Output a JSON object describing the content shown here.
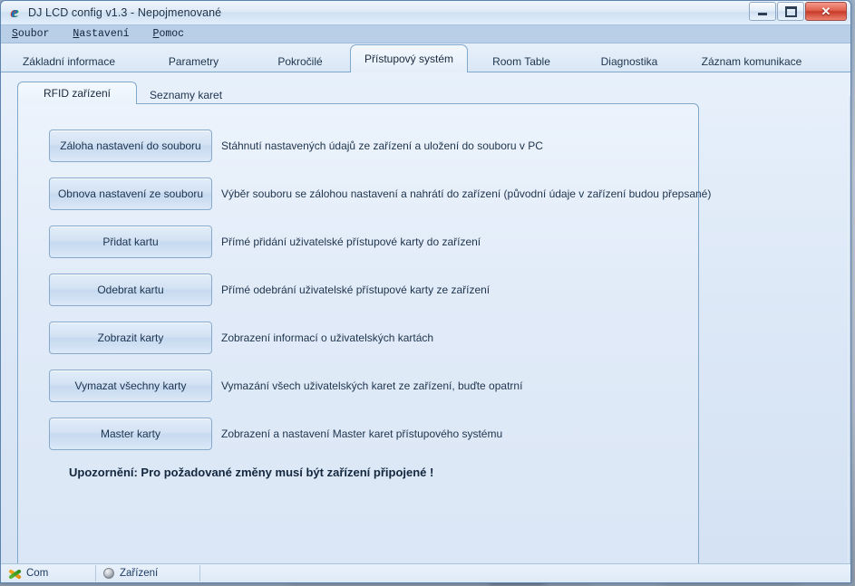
{
  "window": {
    "title": "DJ LCD config v1.3 - Nepojmenované",
    "icon": "ie-logo-icon",
    "controls": {
      "minimize": "–",
      "maximize": "□",
      "close": "✕"
    }
  },
  "menubar": {
    "items": [
      {
        "label": "Soubor",
        "accel": "S",
        "rest": "oubor"
      },
      {
        "label": "Nastavení",
        "accel": "N",
        "rest": "astavení"
      },
      {
        "label": "Pomoc",
        "accel": "P",
        "rest": "omoc"
      }
    ]
  },
  "outer_tabs": {
    "active_index": 3,
    "items": [
      {
        "label": "Základní informace"
      },
      {
        "label": "Parametry"
      },
      {
        "label": "Pokročilé"
      },
      {
        "label": "Přístupový systém"
      },
      {
        "label": "Room Table"
      },
      {
        "label": "Diagnostika"
      },
      {
        "label": "Záznam komunikace"
      }
    ]
  },
  "inner_tabs": {
    "active_index": 0,
    "items": [
      {
        "label": "RFID zařízení"
      },
      {
        "label": "Seznamy karet"
      }
    ]
  },
  "actions": {
    "rows": [
      {
        "button": "Záloha nastavení do souboru",
        "description": "Stáhnutí nastavených údajů ze zařízení a uložení do souboru v PC"
      },
      {
        "button": "Obnova nastavení ze souboru",
        "description": "Výběr souboru se zálohou nastavení a nahrátí do zařízení (původní údaje v zařízení budou přepsané)"
      },
      {
        "button": "Přidat kartu",
        "description": "Přímé přidání uživatelské přístupové karty do zařízení"
      },
      {
        "button": "Odebrat kartu",
        "description": "Přímé odebrání uživatelské přístupové karty ze zařízení"
      },
      {
        "button": "Zobrazit karty",
        "description": "Zobrazení informací o uživatelských kartách"
      },
      {
        "button": "Vymazat všechny karty",
        "description": "Vymazání všech uživatelských karet ze zařízení, buďte opatrní"
      },
      {
        "button": "Master karty",
        "description": "Zobrazení a nastavení Master karet přístupového systému"
      }
    ],
    "notice": "Upozornění: Pro požadované změny musí být zařízení připojené !"
  },
  "statusbar": {
    "cells": [
      {
        "label": "Com",
        "icon": "com-connector-icon"
      },
      {
        "label": "Zařízení",
        "icon": "device-status-led-icon"
      },
      {
        "label": "",
        "icon": ""
      }
    ]
  },
  "colors": {
    "accent_border": "#7fa8cd",
    "title_text": "#20344a",
    "body_text": "#20364f",
    "close_button": "#c63a28",
    "panel_bg": "#e1ebf8",
    "menubar_bg": "#b9cfe8"
  }
}
